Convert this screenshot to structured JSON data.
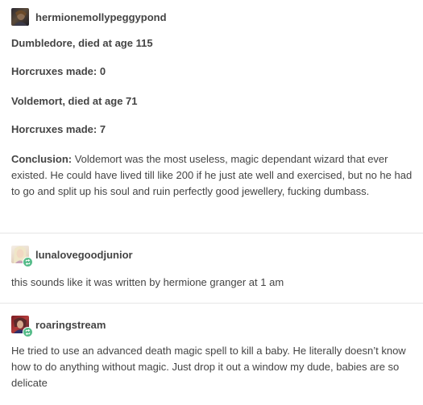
{
  "posts": [
    {
      "username": "hermionemollypeggypond",
      "lines": [
        "Dumbledore, died at age 115",
        "Horcruxes made: 0",
        "Voldemort, died at age 71",
        "Horcruxes made: 7"
      ],
      "conclusion_label": "Conclusion:",
      "conclusion_text": " Voldemort was the most useless, magic dependant wizard that ever existed. He could have lived till like 200 if he just ate well and exercised, but no he had to go and split up his soul and ruin perfectly good jewellery, fucking dumbass.",
      "avatar_icon": "avatar-dark-portrait-icon"
    },
    {
      "username": "lunalovegoodjunior",
      "text": "this sounds like it was written by hermione granger at 1 am",
      "avatar_icon": "avatar-light-portrait-icon",
      "badge_icon": "reblog-icon"
    },
    {
      "username": "roaringstream",
      "text": "He tried to use an advanced death magic spell to kill a baby. He literally doesn’t know how to do anything without magic. Just drop it out a window my dude, babies are so delicate",
      "avatar_icon": "avatar-red-portrait-icon",
      "badge_icon": "reblog-icon"
    }
  ],
  "colors": {
    "text": "#444444",
    "divider": "#e6e6e6",
    "reblog_badge": "#56bc8a"
  }
}
